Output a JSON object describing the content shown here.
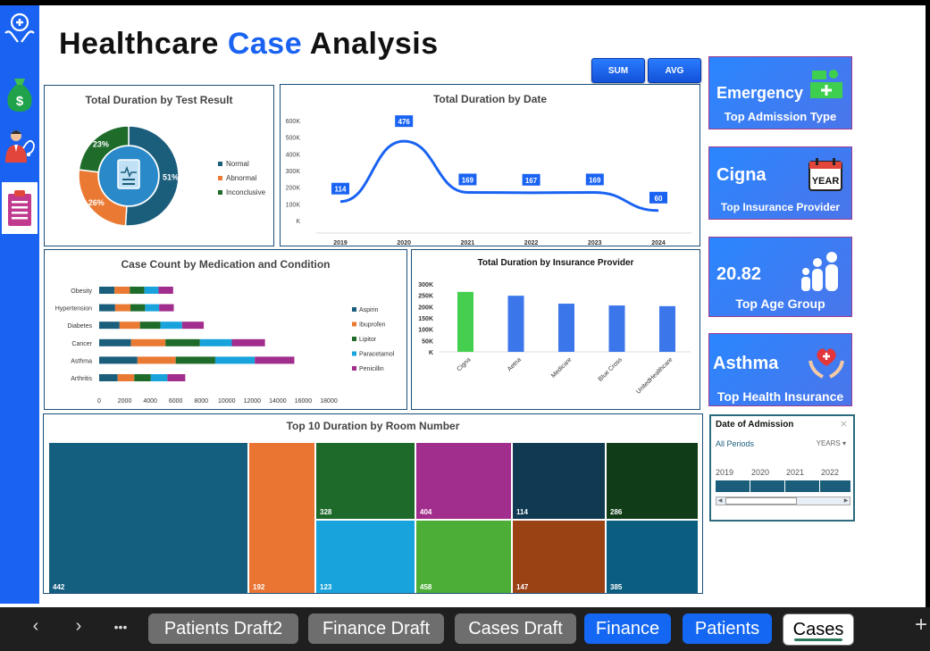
{
  "title": {
    "part1": "Healthcare",
    "part2": "Case",
    "part3": "Analysis"
  },
  "buttons": {
    "sum": "SUM",
    "avg": "AVG"
  },
  "colors": {
    "accent": "#1a63f2",
    "navy": "#1b5e7c",
    "orange": "#ea7a33",
    "green": "#1e6b2a"
  },
  "sidebar": {
    "items": [
      {
        "icon": "healthcare-hands-icon"
      },
      {
        "icon": "money-bag-icon"
      },
      {
        "icon": "doctor-icon"
      },
      {
        "icon": "clipboard-report-icon"
      }
    ]
  },
  "kpis": [
    {
      "value": "Emergency",
      "label": "Top Admission Type",
      "icon": "hospital-bed-icon"
    },
    {
      "value": "Cigna",
      "label": "Top Insurance Provider",
      "icon": "calendar-year-icon"
    },
    {
      "value": "20.82",
      "label": "Top Age Group",
      "icon": "family-icon"
    },
    {
      "value": "Asthma",
      "label": "Top Health Insurance",
      "icon": "heart-hands-icon"
    }
  ],
  "donut": {
    "title": "Total Duration by Test Result",
    "slices": [
      {
        "name": "Normal",
        "value": 51,
        "label": "51%",
        "color": "#1b5e7c"
      },
      {
        "name": "Abnormal",
        "value": 26,
        "label": "26%",
        "color": "#ea7a33"
      },
      {
        "name": "Inconclusive",
        "value": 23,
        "label": "23%",
        "color": "#1e6b2a"
      }
    ]
  },
  "slicer": {
    "title": "Date of Admission",
    "period": "All Periods",
    "unit": "YEARS",
    "years": [
      "2019",
      "2020",
      "2021",
      "2022"
    ]
  },
  "tabs": {
    "more": "•••",
    "items": [
      {
        "label": "Patients Draft2",
        "style": "grey"
      },
      {
        "label": "Finance Draft",
        "style": "grey"
      },
      {
        "label": "Cases Draft",
        "style": "grey"
      },
      {
        "label": "Finance",
        "style": "blue"
      },
      {
        "label": "Patients",
        "style": "blue"
      },
      {
        "label": "Cases",
        "style": "active"
      }
    ]
  },
  "chart_data": [
    {
      "type": "pie",
      "title": "Total Duration by Test Result",
      "categories": [
        "Normal",
        "Abnormal",
        "Inconclusive"
      ],
      "values": [
        51,
        26,
        23
      ],
      "legend": "right"
    },
    {
      "type": "line",
      "title": "Total Duration by Date",
      "x": [
        "2019",
        "2020",
        "2021",
        "2022",
        "2023",
        "2024"
      ],
      "values": [
        114,
        476,
        169,
        167,
        169,
        60
      ],
      "yticks": [
        "600K",
        "500K",
        "400K",
        "300K",
        "200K",
        "100K",
        "K"
      ],
      "ylim": [
        0,
        600
      ]
    },
    {
      "type": "bar",
      "orientation": "horizontal",
      "stacked": true,
      "title": "Case Count by Medication and Condition",
      "categories": [
        "Obesity",
        "Hypertension",
        "Diabetes",
        "Cancer",
        "Asthma",
        "Arthritis"
      ],
      "series": [
        {
          "name": "Aspirin",
          "color": "#1b5e7c",
          "values": [
            1200,
            1250,
            1600,
            2500,
            3000,
            1450
          ]
        },
        {
          "name": "Ibuprofen",
          "color": "#ea7a33",
          "values": [
            1200,
            1200,
            1600,
            2700,
            3000,
            1300
          ]
        },
        {
          "name": "Lipitor",
          "color": "#1e6b2a",
          "values": [
            1150,
            1150,
            1600,
            2700,
            3100,
            1300
          ]
        },
        {
          "name": "Paracetamol",
          "color": "#18a3dc",
          "values": [
            1100,
            1100,
            1700,
            2500,
            3100,
            1300
          ]
        },
        {
          "name": "Penicillin",
          "color": "#a12d8c",
          "values": [
            1150,
            1150,
            1700,
            2600,
            3100,
            1400
          ]
        }
      ],
      "xticks": [
        "0",
        "2000",
        "4000",
        "6000",
        "8000",
        "10000",
        "12000",
        "14000",
        "16000",
        "18000"
      ],
      "xlim": [
        0,
        18000
      ],
      "legend": "right"
    },
    {
      "type": "bar",
      "title": "Total Duration by Insurance Provider",
      "categories": [
        "Cigna",
        "Aetna",
        "Medicare",
        "Blue Cross",
        "UnitedHealthcare"
      ],
      "values": [
        265,
        248,
        213,
        205,
        202
      ],
      "yticks": [
        "300K",
        "250K",
        "200K",
        "150K",
        "100K",
        "50K",
        "K"
      ],
      "ylim": [
        0,
        300
      ]
    },
    {
      "type": "heatmap",
      "subtype": "treemap",
      "title": "Top 10 Duration by Room Number",
      "cells": [
        {
          "label": "442",
          "value": 442,
          "color": "#145e80"
        },
        {
          "label": "192",
          "value": 192,
          "color": "#ea7533"
        },
        {
          "label": "328",
          "value": 328,
          "color": "#1d6a2a"
        },
        {
          "label": "123",
          "value": 123,
          "color": "#18a3dc"
        },
        {
          "label": "404",
          "value": 404,
          "color": "#a12d8c"
        },
        {
          "label": "458",
          "value": 458,
          "color": "#4cae36"
        },
        {
          "label": "114",
          "value": 114,
          "color": "#0f3a52"
        },
        {
          "label": "147",
          "value": 147,
          "color": "#9a4214"
        },
        {
          "label": "286",
          "value": 286,
          "color": "#103d18"
        },
        {
          "label": "385",
          "value": 385,
          "color": "#0c5e80"
        }
      ]
    }
  ]
}
